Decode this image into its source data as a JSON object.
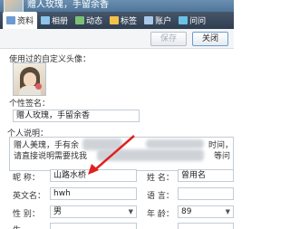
{
  "window": {
    "title": "赠人玫瑰，手留余香"
  },
  "tabs": [
    {
      "label": "资料",
      "icon": "profile-icon",
      "active": true
    },
    {
      "label": "相册",
      "icon": "album-icon",
      "active": false
    },
    {
      "label": "动态",
      "icon": "feed-icon",
      "active": false
    },
    {
      "label": "标签",
      "icon": "tag-icon",
      "active": false
    },
    {
      "label": "账户",
      "icon": "account-icon",
      "active": false
    },
    {
      "label": "问问",
      "icon": "question-icon",
      "active": false
    }
  ],
  "toolbar": {
    "save_label": "保存",
    "close_label": "关闭"
  },
  "profile": {
    "avatar_label": "使用过的自定义头像：",
    "signature_label": "个性签名：",
    "signature_value": "赠人玫瑰，手留余香",
    "description_label": "个人说明：",
    "description_line1": "赠人美瑰，手有余",
    "description_line2": "时间，",
    "description_line3": "请直接说明需要找我",
    "description_line4": "等问",
    "fields": {
      "nickname_label": "昵    称：",
      "nickname_value": "山路水桥",
      "name_label": "姓    名：",
      "name_value": "曾用名",
      "english_label": "英文名：",
      "english_value": "hwh",
      "language_label": "语    言：",
      "language_value": "",
      "gender_label": "性    别：",
      "gender_value": "男",
      "age_label": "年    龄：",
      "age_value": "89"
    }
  },
  "colors": {
    "title_bar": "#5a7fa2",
    "tab_bar": "#3a4a5e",
    "arrow": "#e02020",
    "close_button_border": "#6a9bd0"
  }
}
